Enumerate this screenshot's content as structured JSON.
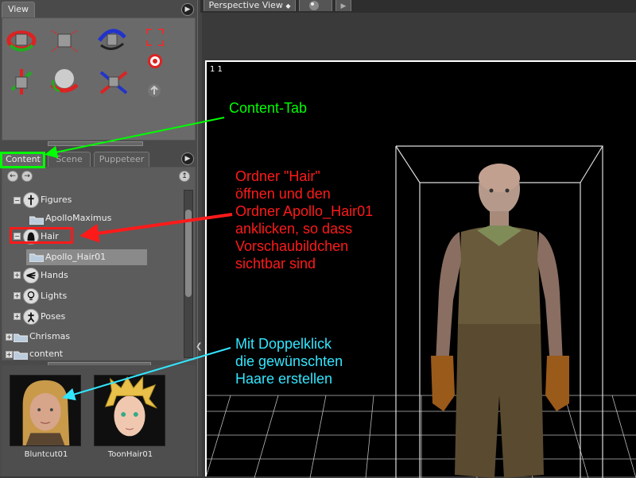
{
  "view_panel": {
    "tab_label": "View"
  },
  "viewport": {
    "tab_label": "Perspective View",
    "dropdown_caret": "◆",
    "play_icon": "▶",
    "corner_label": "1  1"
  },
  "content_panel": {
    "tabs": [
      "Content",
      "Scene",
      "Puppeteer"
    ],
    "tree": [
      {
        "label": "Figures",
        "icon": "figure-icon",
        "expander": "−"
      },
      {
        "label": "ApolloMaximus",
        "icon": "folder-icon",
        "expander": ""
      },
      {
        "label": "Hair",
        "icon": "hair-icon",
        "expander": "−"
      },
      {
        "label": "Apollo_Hair01",
        "icon": "folder-icon",
        "expander": "",
        "selected": true
      },
      {
        "label": "Hands",
        "icon": "hand-icon",
        "expander": "+"
      },
      {
        "label": "Lights",
        "icon": "lightbulb-icon",
        "expander": "+"
      },
      {
        "label": "Poses",
        "icon": "pose-icon",
        "expander": "+"
      },
      {
        "label": "Chrismas",
        "icon": "folder-icon",
        "expander": "+"
      },
      {
        "label": "content",
        "icon": "folder-icon",
        "expander": "+"
      }
    ],
    "thumbnails": [
      {
        "label": "Bluntcut01"
      },
      {
        "label": "ToonHair01"
      }
    ]
  },
  "annotations": {
    "content_tab": "Content-Tab",
    "hair_instructions": [
      "Ordner \"Hair\"",
      "öffnen und den",
      "Ordner Apollo_Hair01",
      "anklicken, so dass",
      "Vorschaubildchen",
      "sichtbar sind"
    ],
    "double_click": [
      "Mit Doppelklick",
      "die gewünschten",
      "Haare erstellen"
    ]
  },
  "colors": {
    "annotation_green": "#00ff00",
    "annotation_red": "#ff1a1a",
    "annotation_cyan": "#33e6ff"
  }
}
